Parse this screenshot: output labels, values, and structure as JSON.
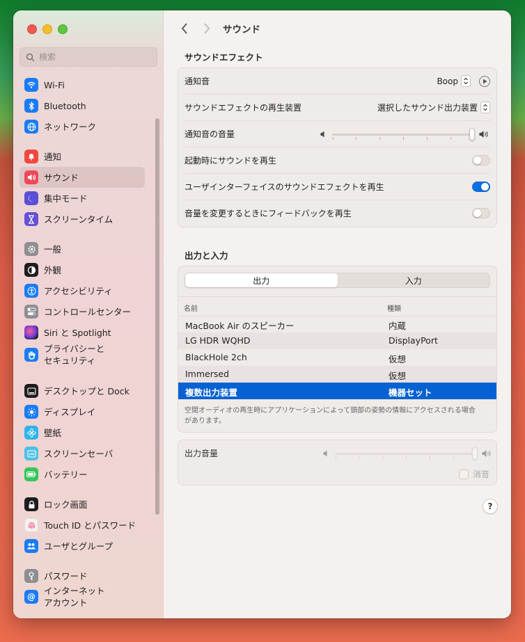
{
  "window": {
    "title": "サウンド"
  },
  "search": {
    "placeholder": "検索"
  },
  "sidebar": {
    "items": [
      {
        "label": "Wi-Fi",
        "icon": "wifi-icon",
        "color": "#1a7cf5"
      },
      {
        "label": "Bluetooth",
        "icon": "bluetooth-icon",
        "color": "#1a7cf5"
      },
      {
        "label": "ネットワーク",
        "icon": "globe-icon",
        "color": "#1a7cf5"
      },
      {
        "label": "通知",
        "icon": "bell-icon",
        "color": "#f0473f"
      },
      {
        "label": "サウンド",
        "icon": "speaker-icon",
        "color": "#f0475a"
      },
      {
        "label": "集中モード",
        "icon": "moon-icon",
        "color": "#5a4fd6"
      },
      {
        "label": "スクリーンタイム",
        "icon": "hourglass-icon",
        "color": "#6550d6"
      },
      {
        "label": "一般",
        "icon": "gear-icon",
        "color": "#8e8e93"
      },
      {
        "label": "外観",
        "icon": "appearance-icon",
        "color": "#1d1d1f"
      },
      {
        "label": "アクセシビリティ",
        "icon": "accessibility-icon",
        "color": "#1a7cf5"
      },
      {
        "label": "コントロールセンター",
        "icon": "toggles-icon",
        "color": "#8e8e93"
      },
      {
        "label": "Siri と Spotlight",
        "icon": "siri-icon",
        "color": "#6a3ad1"
      },
      {
        "label": "プライバシーと\nセキュリティ",
        "icon": "hand-icon",
        "color": "#1a7cf5"
      },
      {
        "label": "デスクトップと Dock",
        "icon": "dock-icon",
        "color": "#1d1d1f"
      },
      {
        "label": "ディスプレイ",
        "icon": "sun-icon",
        "color": "#1a7cf5"
      },
      {
        "label": "壁紙",
        "icon": "flower-icon",
        "color": "#2fb5e8"
      },
      {
        "label": "スクリーンセーバ",
        "icon": "screensaver-icon",
        "color": "#4ec0e8"
      },
      {
        "label": "バッテリー",
        "icon": "battery-icon",
        "color": "#34c759"
      },
      {
        "label": "ロック画面",
        "icon": "lock-icon",
        "color": "#1d1d1f"
      },
      {
        "label": "Touch ID とパスワード",
        "icon": "fingerprint-icon",
        "color": "#f4f1f1"
      },
      {
        "label": "ユーザとグループ",
        "icon": "users-icon",
        "color": "#1a7cf5"
      },
      {
        "label": "パスワード",
        "icon": "key-icon",
        "color": "#8e8e93"
      },
      {
        "label": "インターネット\nアカウント",
        "icon": "at-icon",
        "color": "#1a7cf5"
      }
    ]
  },
  "sound_effects": {
    "section_title": "サウンドエフェクト",
    "alert_sound": {
      "label": "通知音",
      "value": "Boop"
    },
    "play_device": {
      "label": "サウンドエフェクトの再生装置",
      "value": "選択したサウンド出力装置"
    },
    "alert_volume": {
      "label": "通知音の音量",
      "level": 1.0
    },
    "startup_sound": {
      "label": "起動時にサウンドを再生",
      "on": false
    },
    "ui_effects": {
      "label": "ユーザインターフェイスのサウンドエフェクトを再生",
      "on": true
    },
    "volume_feedback": {
      "label": "音量を変更するときにフィードバックを再生",
      "on": false
    }
  },
  "output_input": {
    "section_title": "出力と入力",
    "tabs": [
      "出力",
      "入力"
    ],
    "selected_tab": 0,
    "columns": [
      "名前",
      "種類"
    ],
    "devices": [
      {
        "name": "MacBook Air のスピーカー",
        "type": "内蔵"
      },
      {
        "name": "LG HDR WQHD",
        "type": "DisplayPort"
      },
      {
        "name": "BlackHole 2ch",
        "type": "仮想"
      },
      {
        "name": "Immersed",
        "type": "仮想"
      },
      {
        "name": "複数出力装置",
        "type": "機器セット"
      }
    ],
    "selected_device": 4,
    "note": "空間オーディオの再生時にアプリケーションによって頭部の姿勢の情報にアクセスされる場合があります。"
  },
  "output_volume": {
    "label": "出力音量",
    "level": 1.0,
    "mute_label": "消音",
    "muted": false
  },
  "help_label": "?",
  "colors": {
    "accent": "#0b6fdf",
    "selection": "#0661d2"
  }
}
